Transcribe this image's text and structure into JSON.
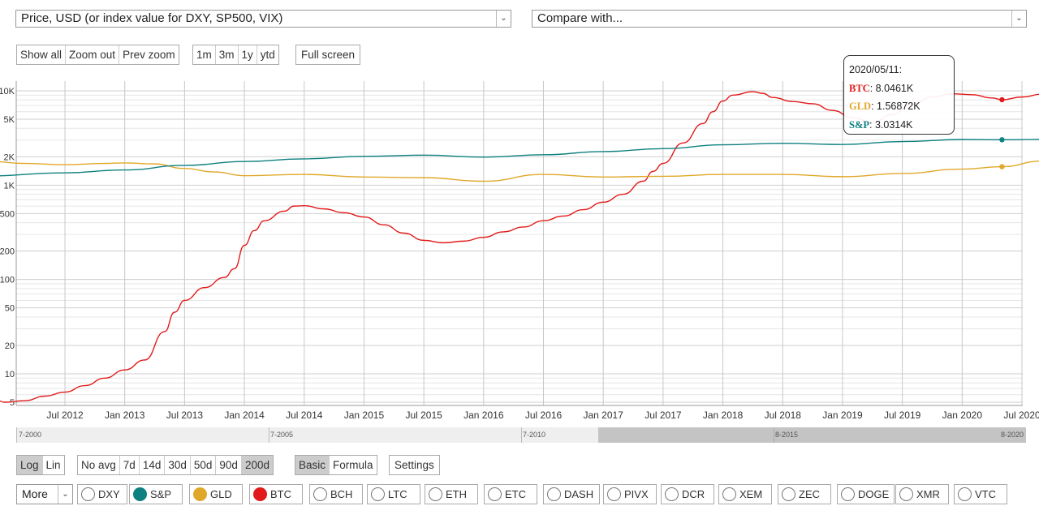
{
  "controls": {
    "metric_select": "Price, USD (or index value for DXY, SP500, VIX)",
    "compare_select": "Compare with...",
    "zoom_buttons": [
      "Show all",
      "Zoom out",
      "Prev zoom"
    ],
    "range_buttons": [
      "1m",
      "3m",
      "1y",
      "ytd"
    ],
    "fullscreen": "Full screen",
    "scale_buttons": [
      "Log",
      "Lin"
    ],
    "scale_selected": "Log",
    "avg_buttons": [
      "No avg",
      "7d",
      "14d",
      "30d",
      "50d",
      "90d",
      "200d"
    ],
    "avg_selected": "200d",
    "mode_buttons": [
      "Basic",
      "Formula"
    ],
    "mode_selected": "Basic",
    "settings": "Settings",
    "more": "More"
  },
  "coins": [
    {
      "label": "DXY",
      "color": "",
      "active": false
    },
    {
      "label": "S&P",
      "color": "#0e8080",
      "active": true
    },
    {
      "label": "GLD",
      "color": "#e0a82a",
      "active": true
    },
    {
      "label": "BTC",
      "color": "#e21a1a",
      "active": true
    },
    {
      "label": "BCH",
      "color": "",
      "active": false
    },
    {
      "label": "LTC",
      "color": "",
      "active": false
    },
    {
      "label": "ETH",
      "color": "",
      "active": false
    },
    {
      "label": "ETC",
      "color": "",
      "active": false
    },
    {
      "label": "DASH",
      "color": "",
      "active": false
    },
    {
      "label": "PIVX",
      "color": "",
      "active": false
    },
    {
      "label": "DCR",
      "color": "",
      "active": false
    },
    {
      "label": "XEM",
      "color": "",
      "active": false
    },
    {
      "label": "ZEC",
      "color": "",
      "active": false
    },
    {
      "label": "DOGE",
      "color": "",
      "active": false
    },
    {
      "label": "XMR",
      "color": "",
      "active": false
    },
    {
      "label": "VTC",
      "color": "",
      "active": false
    }
  ],
  "tooltip": {
    "date": "2020/05/11:",
    "rows": [
      {
        "name": "BTC",
        "value": "8.0461K",
        "color": "#e21a1a"
      },
      {
        "name": "GLD",
        "value": "1.56872K",
        "color": "#e0a82a"
      },
      {
        "name": "S&P",
        "value": "3.0314K",
        "color": "#0e8080"
      }
    ]
  },
  "navigator": {
    "labels": [
      "7-2000",
      "7-2005",
      "7-2010",
      "8-2015",
      "8-2020"
    ]
  },
  "chart_data": {
    "type": "line",
    "scale": "log",
    "ylim": [
      5,
      11000
    ],
    "x_range": [
      "2011-11",
      "2020-09"
    ],
    "yticks": [
      {
        "v": 5,
        "label": "5"
      },
      {
        "v": 10,
        "label": "10"
      },
      {
        "v": 20,
        "label": "20"
      },
      {
        "v": 50,
        "label": "50"
      },
      {
        "v": 100,
        "label": "100"
      },
      {
        "v": 200,
        "label": "200"
      },
      {
        "v": 500,
        "label": "500"
      },
      {
        "v": 1000,
        "label": "1K"
      },
      {
        "v": 2000,
        "label": "2K"
      },
      {
        "v": 5000,
        "label": "5K"
      },
      {
        "v": 10000,
        "label": "10K"
      }
    ],
    "xticks": [
      "Jul 2012",
      "Jan 2013",
      "Jul 2013",
      "Jan 2014",
      "Jul 2014",
      "Jan 2015",
      "Jul 2015",
      "Jan 2016",
      "Jul 2016",
      "Jan 2017",
      "Jul 2017",
      "Jan 2018",
      "Jul 2018",
      "Jan 2019",
      "Jul 2019",
      "Jan 2020",
      "Jul 2020"
    ],
    "xtick_dates": [
      "2012-07",
      "2013-01",
      "2013-07",
      "2014-01",
      "2014-07",
      "2015-01",
      "2015-07",
      "2016-01",
      "2016-07",
      "2017-01",
      "2017-07",
      "2018-01",
      "2018-07",
      "2019-01",
      "2019-07",
      "2020-01",
      "2020-07"
    ],
    "grid": true,
    "series": [
      {
        "name": "BTC",
        "color": "#e21a1a",
        "points": [
          [
            "2011-11",
            6.5
          ],
          [
            "2012-01",
            5
          ],
          [
            "2012-03",
            5.2
          ],
          [
            "2012-05",
            5.8
          ],
          [
            "2012-07",
            6.4
          ],
          [
            "2012-09",
            7.5
          ],
          [
            "2012-11",
            9
          ],
          [
            "2013-01",
            11
          ],
          [
            "2013-03",
            14
          ],
          [
            "2013-05",
            28
          ],
          [
            "2013-06",
            45
          ],
          [
            "2013-07",
            60
          ],
          [
            "2013-09",
            82
          ],
          [
            "2013-11",
            105
          ],
          [
            "2013-12",
            130
          ],
          [
            "2014-01",
            230
          ],
          [
            "2014-02",
            330
          ],
          [
            "2014-03",
            420
          ],
          [
            "2014-05",
            530
          ],
          [
            "2014-06",
            600
          ],
          [
            "2014-07",
            605
          ],
          [
            "2014-09",
            560
          ],
          [
            "2014-11",
            510
          ],
          [
            "2015-01",
            460
          ],
          [
            "2015-03",
            380
          ],
          [
            "2015-05",
            310
          ],
          [
            "2015-07",
            260
          ],
          [
            "2015-09",
            245
          ],
          [
            "2015-11",
            255
          ],
          [
            "2016-01",
            280
          ],
          [
            "2016-03",
            320
          ],
          [
            "2016-05",
            360
          ],
          [
            "2016-07",
            420
          ],
          [
            "2016-09",
            470
          ],
          [
            "2016-11",
            550
          ],
          [
            "2017-01",
            660
          ],
          [
            "2017-03",
            800
          ],
          [
            "2017-05",
            1100
          ],
          [
            "2017-06",
            1400
          ],
          [
            "2017-07",
            1700
          ],
          [
            "2017-09",
            2800
          ],
          [
            "2017-11",
            4500
          ],
          [
            "2017-12",
            6000
          ],
          [
            "2018-01",
            7800
          ],
          [
            "2018-02",
            9000
          ],
          [
            "2018-04",
            9800
          ],
          [
            "2018-05",
            9400
          ],
          [
            "2018-06",
            8500
          ],
          [
            "2018-08",
            7700
          ],
          [
            "2018-10",
            7300
          ],
          [
            "2018-12",
            6200
          ],
          [
            "2019-02",
            5200
          ],
          [
            "2019-04",
            4600
          ],
          [
            "2019-06",
            5600
          ],
          [
            "2019-08",
            7200
          ],
          [
            "2019-10",
            8600
          ],
          [
            "2019-12",
            9300
          ],
          [
            "2020-02",
            9100
          ],
          [
            "2020-04",
            8400
          ],
          [
            "2020-05",
            8046
          ],
          [
            "2020-07",
            8600
          ],
          [
            "2020-09",
            9200
          ]
        ]
      },
      {
        "name": "GLD",
        "color": "#e0a82a",
        "points": [
          [
            "2011-11",
            1800
          ],
          [
            "2012-03",
            1700
          ],
          [
            "2012-07",
            1650
          ],
          [
            "2012-11",
            1700
          ],
          [
            "2013-01",
            1720
          ],
          [
            "2013-04",
            1680
          ],
          [
            "2013-07",
            1500
          ],
          [
            "2013-10",
            1380
          ],
          [
            "2014-01",
            1260
          ],
          [
            "2014-07",
            1300
          ],
          [
            "2015-01",
            1220
          ],
          [
            "2015-07",
            1200
          ],
          [
            "2016-01",
            1100
          ],
          [
            "2016-07",
            1300
          ],
          [
            "2017-01",
            1220
          ],
          [
            "2017-07",
            1240
          ],
          [
            "2018-01",
            1300
          ],
          [
            "2018-07",
            1300
          ],
          [
            "2019-01",
            1230
          ],
          [
            "2019-07",
            1330
          ],
          [
            "2020-01",
            1480
          ],
          [
            "2020-05",
            1569
          ],
          [
            "2020-09",
            1800
          ]
        ]
      },
      {
        "name": "S&P",
        "color": "#0e8080",
        "points": [
          [
            "2011-11",
            1250
          ],
          [
            "2012-07",
            1350
          ],
          [
            "2013-01",
            1450
          ],
          [
            "2013-07",
            1620
          ],
          [
            "2014-01",
            1780
          ],
          [
            "2014-07",
            1900
          ],
          [
            "2015-01",
            2020
          ],
          [
            "2015-07",
            2080
          ],
          [
            "2016-01",
            1980
          ],
          [
            "2016-07",
            2100
          ],
          [
            "2017-01",
            2270
          ],
          [
            "2017-07",
            2440
          ],
          [
            "2018-01",
            2680
          ],
          [
            "2018-07",
            2780
          ],
          [
            "2019-01",
            2700
          ],
          [
            "2019-07",
            2900
          ],
          [
            "2020-01",
            3050
          ],
          [
            "2020-05",
            3031
          ],
          [
            "2020-09",
            3050
          ]
        ]
      }
    ]
  }
}
